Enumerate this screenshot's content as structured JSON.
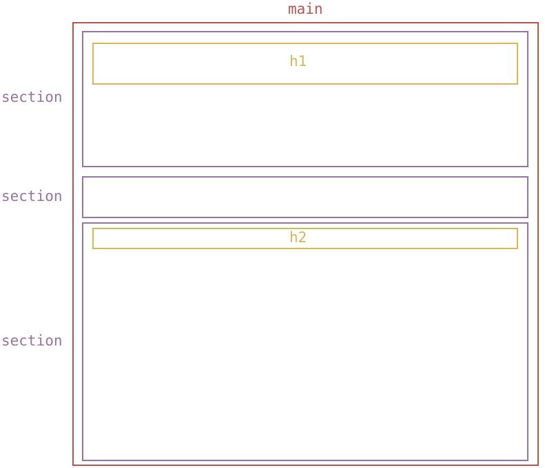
{
  "labels": {
    "main": "main",
    "section_1": "section",
    "section_2": "section",
    "section_3": "section",
    "heading_1": "h1",
    "heading_2": "h2"
  }
}
